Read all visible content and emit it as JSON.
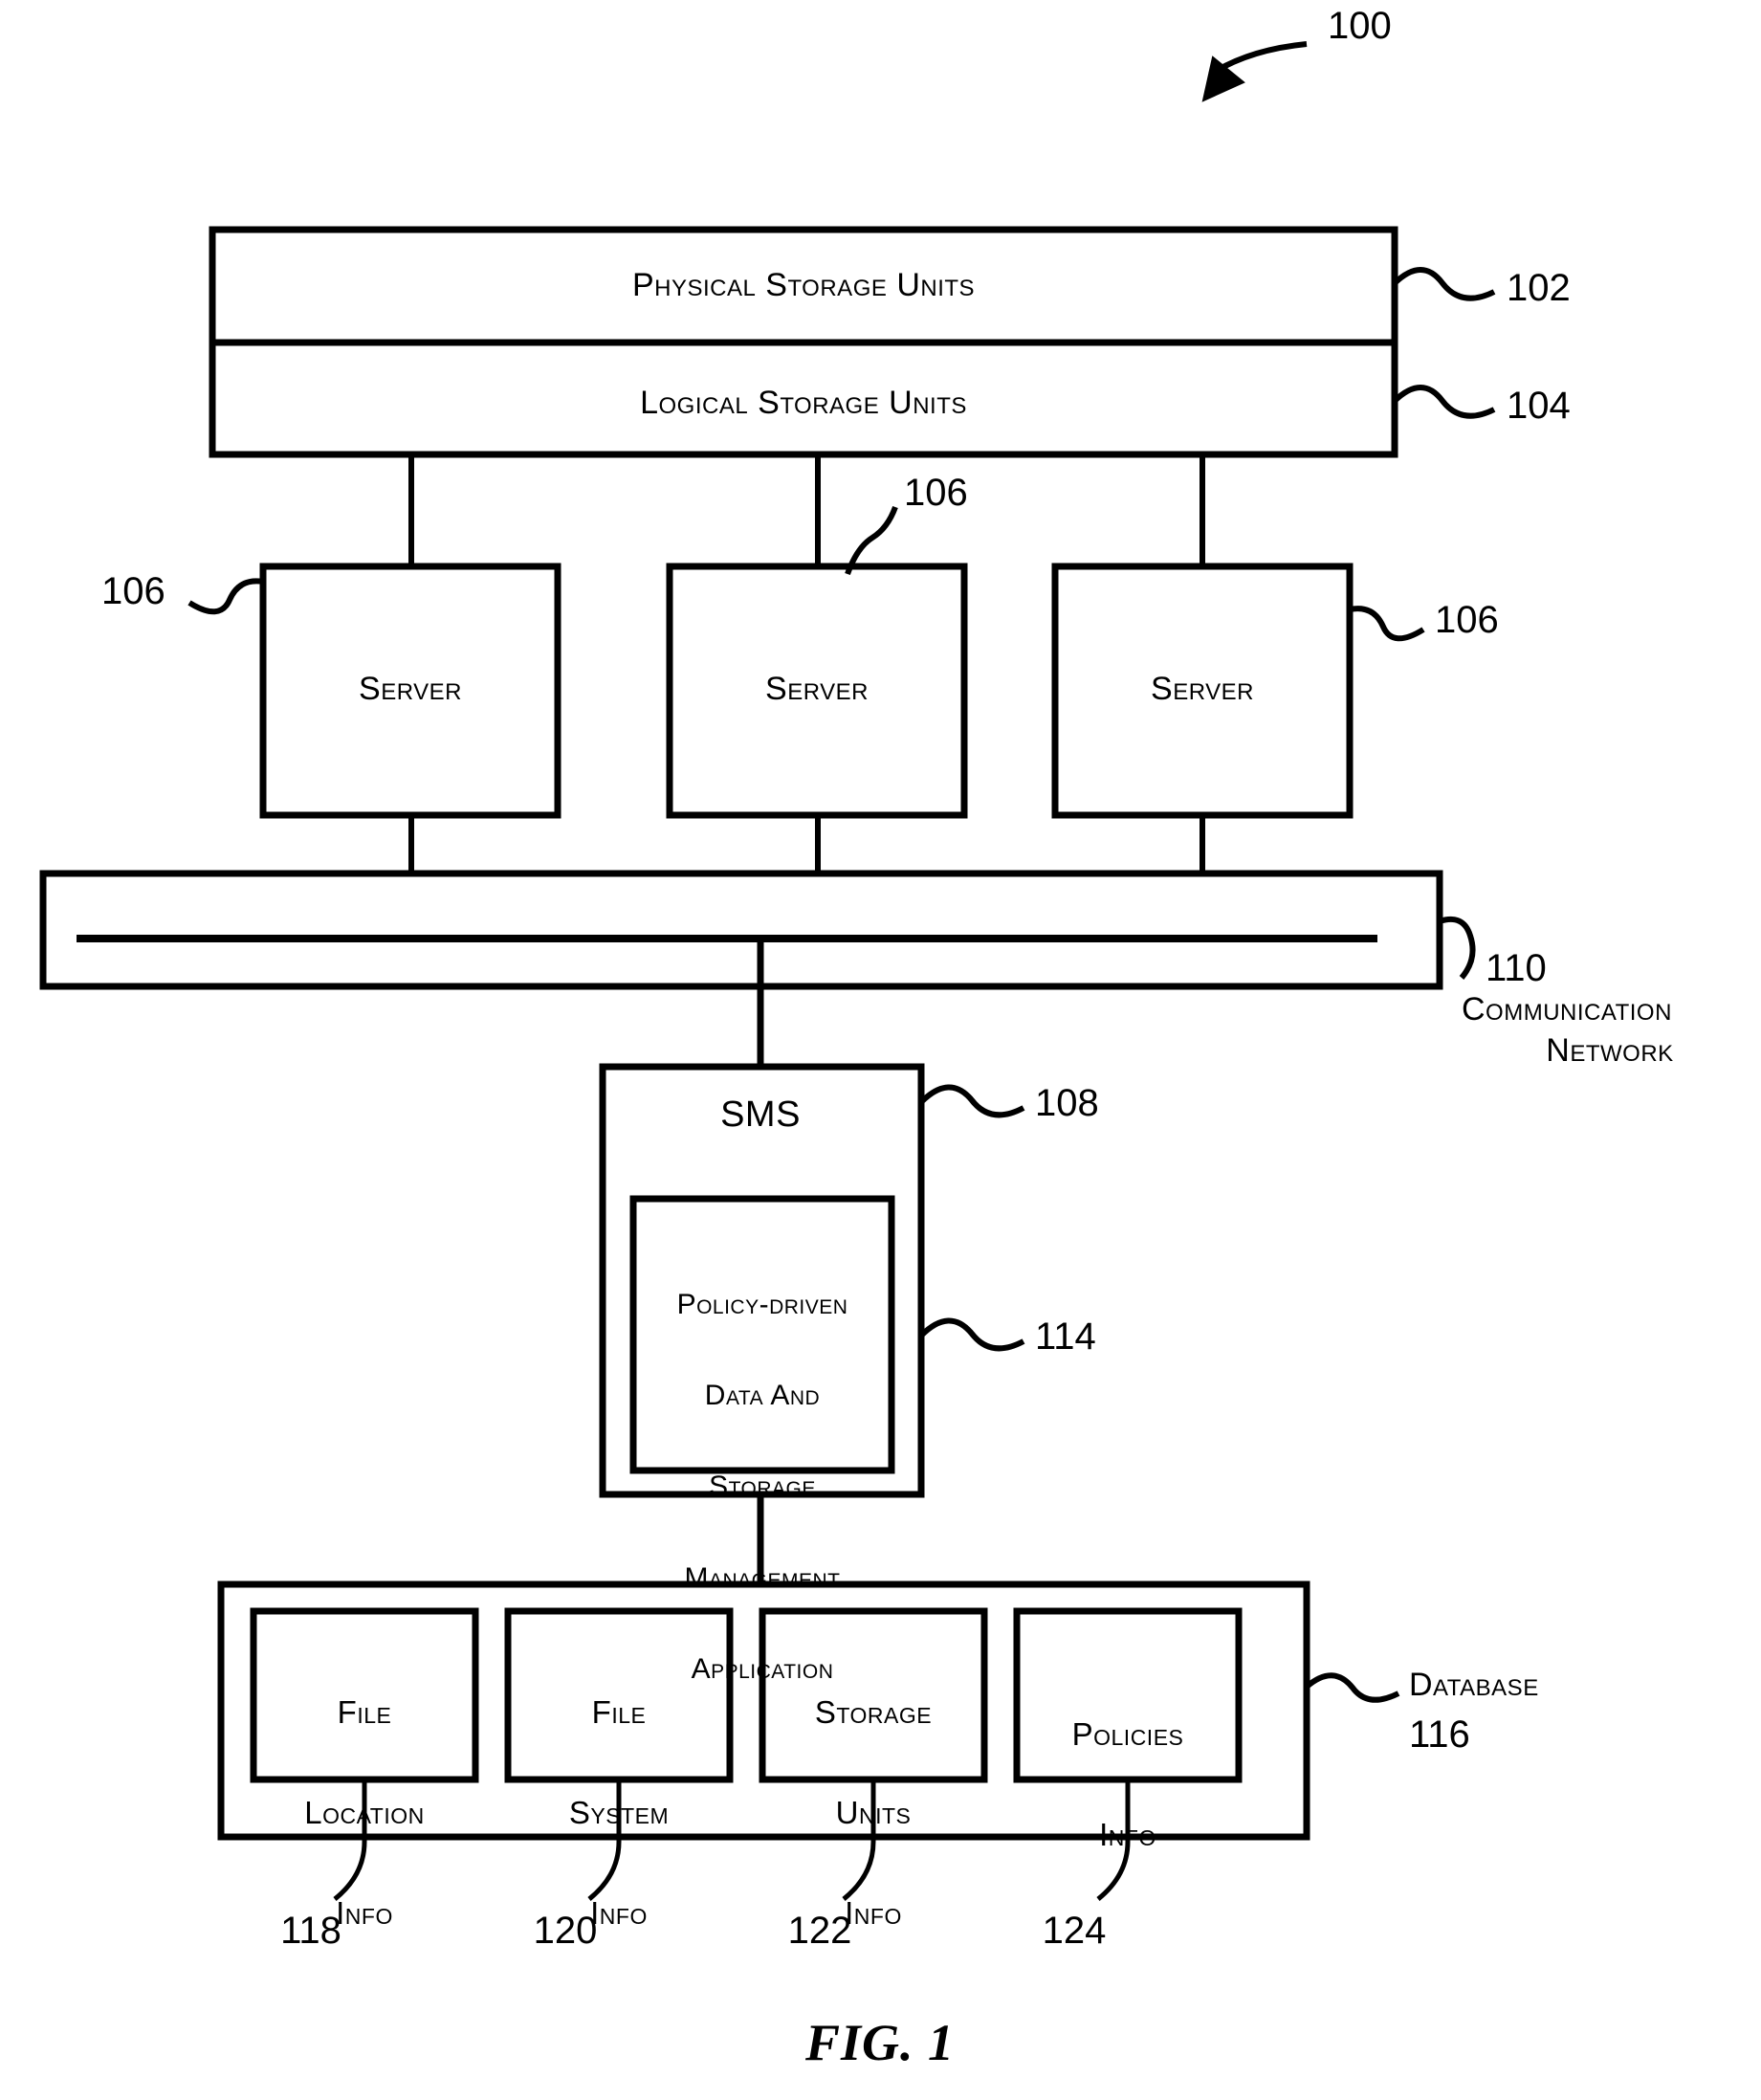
{
  "figure": {
    "caption": "FIG. 1",
    "system_ref": "100"
  },
  "storage": {
    "physical": {
      "label": "Physical Storage Units",
      "ref": "102"
    },
    "logical": {
      "label": "Logical Storage Units",
      "ref": "104"
    }
  },
  "servers": [
    {
      "label": "Server",
      "ref": "106"
    },
    {
      "label": "Server",
      "ref": "106"
    },
    {
      "label": "Server",
      "ref": "106"
    }
  ],
  "network": {
    "ref": "110",
    "label_line1": "Communication",
    "label_line2": "Network"
  },
  "sms": {
    "label": "SMS",
    "ref": "108",
    "application": {
      "ref": "114",
      "lines": [
        "Policy-driven",
        "Data And",
        "Storage",
        "Management",
        "Application"
      ]
    }
  },
  "database": {
    "label": "Database",
    "ref": "116",
    "items": [
      {
        "lines": [
          "File",
          "Location",
          "Info"
        ],
        "ref": "118"
      },
      {
        "lines": [
          "File",
          "System",
          "Info"
        ],
        "ref": "120"
      },
      {
        "lines": [
          "Storage",
          "Units",
          "Info"
        ],
        "ref": "122"
      },
      {
        "lines": [
          "Policies",
          "Info"
        ],
        "ref": "124"
      }
    ]
  },
  "colors": {
    "ink": "#000000",
    "paper": "#ffffff"
  }
}
